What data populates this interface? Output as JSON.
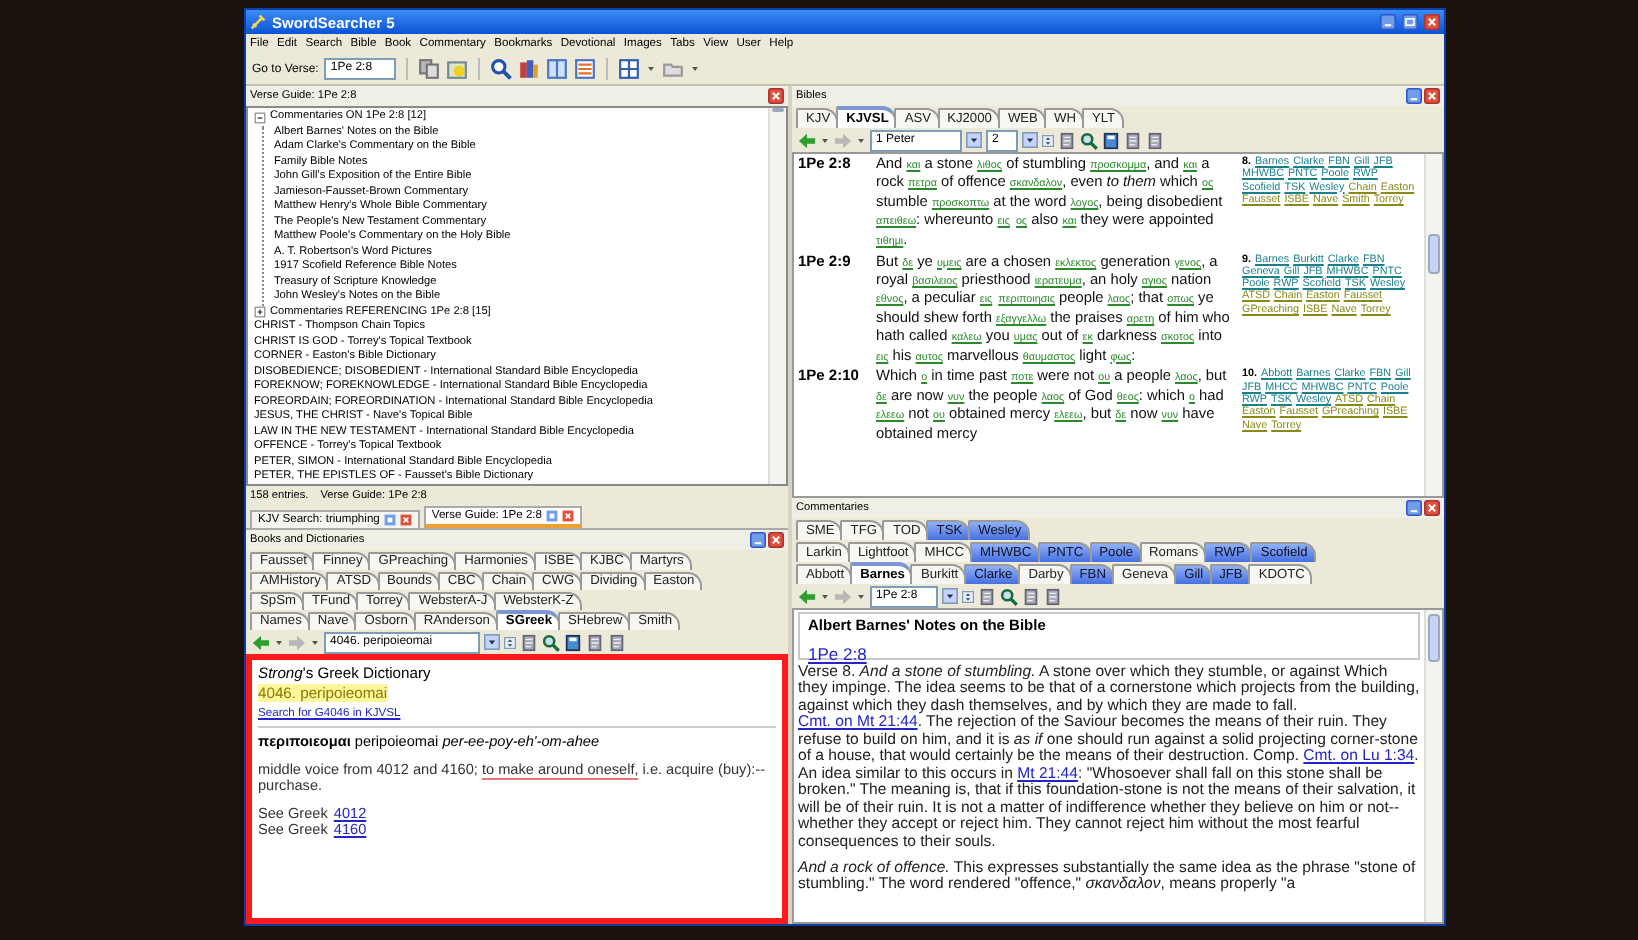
{
  "window": {
    "title": "SwordSearcher 5"
  },
  "menu": [
    "File",
    "Edit",
    "Search",
    "Bible",
    "Book",
    "Commentary",
    "Bookmarks",
    "Devotional",
    "Images",
    "Tabs",
    "View",
    "User",
    "Help"
  ],
  "toolbar": {
    "goto_label": "Go to Verse:",
    "goto_value": "1Pe 2:8"
  },
  "verse_guide": {
    "title": "Verse Guide: 1Pe 2:8",
    "tree": [
      {
        "kind": "group",
        "label": "Commentaries ON 1Pe 2:8 [12]",
        "expanded": true,
        "children": [
          {
            "label": "Albert Barnes' Notes on the Bible"
          },
          {
            "label": "Adam Clarke's Commentary on the Bible"
          },
          {
            "label": "Family Bible Notes"
          },
          {
            "label": "John Gill's Exposition of the Entire Bible"
          },
          {
            "label": "Jamieson-Fausset-Brown Commentary"
          },
          {
            "label": "Matthew Henry's Whole Bible Commentary"
          },
          {
            "label": "The People's New Testament Commentary"
          },
          {
            "label": "Matthew Poole's Commentary on the Holy Bible"
          },
          {
            "label": "A. T. Robertson's Word Pictures"
          },
          {
            "label": "1917 Scofield Reference Bible Notes"
          },
          {
            "label": "Treasury of Scripture Knowledge"
          },
          {
            "label": "John Wesley's Notes on the Bible"
          }
        ]
      },
      {
        "kind": "group",
        "label": "Commentaries REFERENCING 1Pe 2:8 [15]",
        "expanded": false
      },
      {
        "kind": "entry",
        "label": "CHRIST - Thompson Chain Topics"
      },
      {
        "kind": "entry",
        "label": "CHRIST IS GOD - Torrey's Topical Textbook"
      },
      {
        "kind": "entry",
        "label": "CORNER - Easton's Bible Dictionary"
      },
      {
        "kind": "entry",
        "label": "DISOBEDIENCE; DISOBEDIENT - International Standard Bible Encyclopedia"
      },
      {
        "kind": "entry",
        "label": "FOREKNOW; FOREKNOWLEDGE - International Standard Bible Encyclopedia"
      },
      {
        "kind": "entry",
        "label": "FOREORDAIN; FOREORDINATION - International Standard Bible Encyclopedia"
      },
      {
        "kind": "entry",
        "label": "JESUS, THE CHRIST - Nave's Topical Bible"
      },
      {
        "kind": "entry",
        "label": "LAW IN THE NEW TESTAMENT - International Standard Bible Encyclopedia"
      },
      {
        "kind": "entry",
        "label": "OFFENCE - Torrey's Topical Textbook"
      },
      {
        "kind": "entry",
        "label": "PETER, SIMON - International Standard Bible Encyclopedia"
      },
      {
        "kind": "entry",
        "label": "PETER, THE EPISTLES OF - Fausset's Bible Dictionary"
      }
    ],
    "status_count": "158 entries.",
    "status_guide": "Verse Guide: 1Pe 2:8"
  },
  "doc_tabs": [
    {
      "label": "KJV Search: triumphing",
      "selected": false
    },
    {
      "label": "Verse Guide: 1Pe 2:8",
      "selected": true
    }
  ],
  "books": {
    "title": "Books and Dictionaries",
    "annotation_frame": true,
    "tab_rows": [
      [
        {
          "label": "Fausset",
          "selected": false
        },
        {
          "label": "Finney",
          "selected": false
        },
        {
          "label": "GPreaching",
          "selected": false
        },
        {
          "label": "Harmonies",
          "selected": false
        },
        {
          "label": "ISBE",
          "selected": false
        },
        {
          "label": "KJBC",
          "selected": false
        },
        {
          "label": "Martyrs",
          "selected": false
        }
      ],
      [
        {
          "label": "AMHistory",
          "selected": false
        },
        {
          "label": "ATSD",
          "selected": false
        },
        {
          "label": "Bounds",
          "selected": false
        },
        {
          "label": "CBC",
          "selected": false
        },
        {
          "label": "Chain",
          "selected": false
        },
        {
          "label": "CWG",
          "selected": false
        },
        {
          "label": "Dividing",
          "selected": false
        },
        {
          "label": "Easton",
          "selected": false
        }
      ],
      [
        {
          "label": "SpSm",
          "selected": false
        },
        {
          "label": "TFund",
          "selected": false
        },
        {
          "label": "Torrey",
          "selected": false
        },
        {
          "label": "WebsterA-J",
          "selected": false
        },
        {
          "label": "WebsterK-Z",
          "selected": false
        }
      ],
      [
        {
          "label": "Names",
          "selected": false
        },
        {
          "label": "Nave",
          "selected": false
        },
        {
          "label": "Osborn",
          "selected": false
        },
        {
          "label": "RAnderson",
          "selected": false
        },
        {
          "label": "SGreek",
          "selected": true
        },
        {
          "label": "SHebrew",
          "selected": false
        },
        {
          "label": "Smith",
          "selected": false
        }
      ]
    ],
    "nav_entry": "4046. peripoieomai",
    "entry": {
      "source": "*Strong*'s Greek Dictionary",
      "heading": "4046. peripoieomai",
      "search_link": "Search for G4046 in KJVSL",
      "headword": "**περιποιεομαι** peripoieomai *per-ee-poy-eh'-om-ahee*",
      "definition": [
        {
          "kind": "text",
          "text": "middle voice from 4012 and 4160; "
        },
        {
          "kind": "marked",
          "text": "to make around oneself,"
        },
        {
          "kind": "text",
          "text": " i.e. acquire (buy):--purchase."
        }
      ],
      "see_also": [
        {
          "label": "See Greek",
          "link": "4012"
        },
        {
          "label": "See Greek",
          "link": "4160"
        }
      ]
    }
  },
  "bibles": {
    "title": "Bibles",
    "tabs": [
      {
        "label": "KJV",
        "selected": false
      },
      {
        "label": "KJVSL",
        "selected": true
      },
      {
        "label": "ASV",
        "selected": false
      },
      {
        "label": "KJ2000",
        "selected": false
      },
      {
        "label": "WEB",
        "selected": false
      },
      {
        "label": "WH",
        "selected": false
      },
      {
        "label": "YLT",
        "selected": false
      }
    ],
    "book": "1 Peter",
    "chapter": "2",
    "verses": [
      {
        "ref": "1Pe 2:8",
        "segments": [
          {
            "kind": "english",
            "text": "And "
          },
          {
            "kind": "strongs",
            "text": "και"
          },
          {
            "kind": "english",
            "text": " a stone "
          },
          {
            "kind": "strongs",
            "text": "λιθος"
          },
          {
            "kind": "english",
            "text": " of stumbling "
          },
          {
            "kind": "strongs",
            "text": "προσκομμα"
          },
          {
            "kind": "english",
            "text": ", and "
          },
          {
            "kind": "strongs",
            "text": "και"
          },
          {
            "kind": "english",
            "text": " a rock "
          },
          {
            "kind": "strongs",
            "text": "πετρα"
          },
          {
            "kind": "english",
            "text": " of offence "
          },
          {
            "kind": "strongs",
            "text": "σκανδαλον"
          },
          {
            "kind": "english",
            "text": ", even *to them* which "
          },
          {
            "kind": "strongs",
            "text": "ος"
          },
          {
            "kind": "english",
            "text": " stumble "
          },
          {
            "kind": "strongs",
            "text": "προσκοπτω"
          },
          {
            "kind": "english",
            "text": " at the word "
          },
          {
            "kind": "strongs",
            "text": "λογος"
          },
          {
            "kind": "english",
            "text": ", being disobedient "
          },
          {
            "kind": "strongs",
            "text": "απειθεω"
          },
          {
            "kind": "english",
            "text": ": whereunto "
          },
          {
            "kind": "strongs",
            "text": "εις"
          },
          {
            "kind": "strongs",
            "text": "ος"
          },
          {
            "kind": "english",
            "text": " also "
          },
          {
            "kind": "strongs",
            "text": "και"
          },
          {
            "kind": "english",
            "text": " they were appointed "
          },
          {
            "kind": "strongs",
            "text": "τιθημι"
          },
          {
            "kind": "english",
            "text": "."
          }
        ],
        "xref": {
          "number": "8.",
          "commentaries": [
            "Barnes",
            "Clarke",
            "FBN",
            "Gill",
            "JFB",
            "MHWBC",
            "PNTC",
            "Poole",
            "RWP",
            "Scofield",
            "TSK",
            "Wesley"
          ],
          "topics": [
            "Chain",
            "Easton",
            "Fausset",
            "ISBE",
            "Nave",
            "Smith",
            "Torrey"
          ]
        }
      },
      {
        "ref": "1Pe 2:9",
        "segments": [
          {
            "kind": "english",
            "text": "But "
          },
          {
            "kind": "strongs",
            "text": "δε"
          },
          {
            "kind": "english",
            "text": " ye "
          },
          {
            "kind": "strongs",
            "text": "υμεις"
          },
          {
            "kind": "english",
            "text": " are a chosen "
          },
          {
            "kind": "strongs",
            "text": "εκλεκτος"
          },
          {
            "kind": "english",
            "text": " generation "
          },
          {
            "kind": "strongs",
            "text": "γενος"
          },
          {
            "kind": "english",
            "text": ", a royal "
          },
          {
            "kind": "strongs",
            "text": "βασιλειος"
          },
          {
            "kind": "english",
            "text": " priesthood "
          },
          {
            "kind": "strongs",
            "text": "ιερατευμα"
          },
          {
            "kind": "english",
            "text": ", an holy "
          },
          {
            "kind": "strongs",
            "text": "αγιος"
          },
          {
            "kind": "english",
            "text": " nation "
          },
          {
            "kind": "strongs",
            "text": "εθνος"
          },
          {
            "kind": "english",
            "text": ", a peculiar "
          },
          {
            "kind": "strongs",
            "text": "εις"
          },
          {
            "kind": "strongs",
            "text": "περιποιησις"
          },
          {
            "kind": "english",
            "text": " people "
          },
          {
            "kind": "strongs",
            "text": "λαος"
          },
          {
            "kind": "english",
            "text": "; that "
          },
          {
            "kind": "strongs",
            "text": "οπως"
          },
          {
            "kind": "english",
            "text": " ye should shew forth "
          },
          {
            "kind": "strongs",
            "text": "εξαγγελλω"
          },
          {
            "kind": "english",
            "text": " the praises "
          },
          {
            "kind": "strongs",
            "text": "αρετη"
          },
          {
            "kind": "english",
            "text": " of him who hath called "
          },
          {
            "kind": "strongs",
            "text": "καλεω"
          },
          {
            "kind": "english",
            "text": " you "
          },
          {
            "kind": "strongs",
            "text": "υμας"
          },
          {
            "kind": "english",
            "text": " out of "
          },
          {
            "kind": "strongs",
            "text": "εκ"
          },
          {
            "kind": "english",
            "text": " darkness "
          },
          {
            "kind": "strongs",
            "text": "σκοτος"
          },
          {
            "kind": "english",
            "text": " into "
          },
          {
            "kind": "strongs",
            "text": "εις"
          },
          {
            "kind": "english",
            "text": " his "
          },
          {
            "kind": "strongs",
            "text": "αυτος"
          },
          {
            "kind": "english",
            "text": " marvellous "
          },
          {
            "kind": "strongs",
            "text": "θαυμαστος"
          },
          {
            "kind": "english",
            "text": " light "
          },
          {
            "kind": "strongs",
            "text": "φως"
          },
          {
            "kind": "english",
            "text": ":"
          }
        ],
        "xref": {
          "number": "9.",
          "commentaries": [
            "Barnes",
            "Burkitt",
            "Clarke",
            "FBN",
            "Geneva",
            "Gill",
            "JFB",
            "MHWBC",
            "PNTC",
            "Poole",
            "RWP",
            "Scofield",
            "TSK",
            "Wesley"
          ],
          "topics": [
            "ATSD",
            "Chain",
            "Easton",
            "Fausset",
            "GPreaching",
            "ISBE",
            "Nave",
            "Torrey"
          ]
        }
      },
      {
        "ref": "1Pe 2:10",
        "segments": [
          {
            "kind": "english",
            "text": "Which "
          },
          {
            "kind": "strongs",
            "text": "ο"
          },
          {
            "kind": "english",
            "text": " in time past "
          },
          {
            "kind": "strongs",
            "text": "ποτε"
          },
          {
            "kind": "english",
            "text": " were not "
          },
          {
            "kind": "strongs",
            "text": "ου"
          },
          {
            "kind": "english",
            "text": " a people "
          },
          {
            "kind": "strongs",
            "text": "λαος"
          },
          {
            "kind": "english",
            "text": ", but "
          },
          {
            "kind": "strongs",
            "text": "δε"
          },
          {
            "kind": "english",
            "text": " are now "
          },
          {
            "kind": "strongs",
            "text": "νυν"
          },
          {
            "kind": "english",
            "text": " the people "
          },
          {
            "kind": "strongs",
            "text": "λαος"
          },
          {
            "kind": "english",
            "text": " of God "
          },
          {
            "kind": "strongs",
            "text": "θεος"
          },
          {
            "kind": "english",
            "text": ": which "
          },
          {
            "kind": "strongs",
            "text": "ο"
          },
          {
            "kind": "english",
            "text": " had "
          },
          {
            "kind": "strongs",
            "text": "ελεεω"
          },
          {
            "kind": "english",
            "text": " not "
          },
          {
            "kind": "strongs",
            "text": "ου"
          },
          {
            "kind": "english",
            "text": " obtained mercy "
          },
          {
            "kind": "strongs",
            "text": "ελεεω"
          },
          {
            "kind": "english",
            "text": ", but "
          },
          {
            "kind": "strongs",
            "text": "δε"
          },
          {
            "kind": "english",
            "text": " now "
          },
          {
            "kind": "strongs",
            "text": "νυν"
          },
          {
            "kind": "english",
            "text": " have obtained mercy"
          }
        ],
        "xref": {
          "number": "10.",
          "commentaries": [
            "Abbott",
            "Barnes",
            "Clarke",
            "FBN",
            "Gill",
            "JFB",
            "MHCC",
            "MHWBC",
            "PNTC",
            "Poole",
            "RWP",
            "TSK",
            "Wesley"
          ],
          "topics": [
            "ATSD",
            "Chain",
            "Easton",
            "Fausset",
            "GPreaching",
            "ISBE",
            "Nave",
            "Torrey"
          ]
        }
      }
    ]
  },
  "commentaries": {
    "title": "Commentaries",
    "tab_rows": [
      [
        {
          "label": "SME",
          "selected": false,
          "has_notes": false
        },
        {
          "label": "TFG",
          "selected": false,
          "has_notes": false
        },
        {
          "label": "TOD",
          "selected": false,
          "has_notes": false
        },
        {
          "label": "TSK",
          "selected": false,
          "has_notes": true
        },
        {
          "label": "Wesley",
          "selected": false,
          "has_notes": true
        }
      ],
      [
        {
          "label": "Larkin",
          "selected": false,
          "has_notes": false
        },
        {
          "label": "Lightfoot",
          "selected": false,
          "has_notes": false
        },
        {
          "label": "MHCC",
          "selected": false,
          "has_notes": false
        },
        {
          "label": "MHWBC",
          "selected": false,
          "has_notes": true
        },
        {
          "label": "PNTC",
          "selected": false,
          "has_notes": true
        },
        {
          "label": "Poole",
          "selected": false,
          "has_notes": true
        },
        {
          "label": "Romans",
          "selected": false,
          "has_notes": false
        },
        {
          "label": "RWP",
          "selected": false,
          "has_notes": true
        },
        {
          "label": "Scofield",
          "selected": false,
          "has_notes": true
        }
      ],
      [
        {
          "label": "Abbott",
          "selected": false,
          "has_notes": false
        },
        {
          "label": "Barnes",
          "selected": true,
          "has_notes": true
        },
        {
          "label": "Burkitt",
          "selected": false,
          "has_notes": false
        },
        {
          "label": "Clarke",
          "selected": false,
          "has_notes": true
        },
        {
          "label": "Darby",
          "selected": false,
          "has_notes": false
        },
        {
          "label": "FBN",
          "selected": false,
          "has_notes": true
        },
        {
          "label": "Geneva",
          "selected": false,
          "has_notes": false
        },
        {
          "label": "Gill",
          "selected": false,
          "has_notes": true
        },
        {
          "label": "JFB",
          "selected": false,
          "has_notes": true
        },
        {
          "label": "KDOTC",
          "selected": false,
          "has_notes": false
        }
      ]
    ],
    "nav_verse": "1Pe 2:8",
    "heading": "Albert Barnes' Notes on the Bible",
    "heading_link": "1Pe 2:8",
    "paragraphs": [
      [
        {
          "kind": "text",
          "text": "Verse 8. *And a stone of stumbling.* A stone over which they stumble, or against Which they impinge. The idea seems to be that of a cornerstone which projects from the building, against which they dash themselves, and by which they are made to fall. "
        },
        {
          "kind": "link",
          "text": "Cmt. on Mt 21:44"
        },
        {
          "kind": "text",
          "text": ". The rejection of the Saviour becomes the means of their ruin. They refuse to build on him, and it is *as if* one should run against a solid projecting corner-stone of a house, that would certainly be the means of their destruction. Comp. "
        },
        {
          "kind": "link",
          "text": "Cmt. on Lu 1:34"
        },
        {
          "kind": "text",
          "text": ". An idea similar to this occurs in "
        },
        {
          "kind": "link",
          "text": "Mt 21:44"
        },
        {
          "kind": "text",
          "text": ": \"Whosoever shall fall on this stone shall be broken.\" The meaning is, that if this foundation-stone is not the means of their salvation, it will be of their ruin. It is not a matter of indifference whether they believe on him or not--whether they accept or reject him. They cannot reject him without the most fearful consequences to their souls."
        }
      ],
      [
        {
          "kind": "text",
          "text": "*And a rock of offence.* This expresses substantially the same idea as the phrase \"stone of stumbling.\" The word rendered \"offence,\" *σκανδαλον*, means properly \"a"
        }
      ]
    ]
  }
}
